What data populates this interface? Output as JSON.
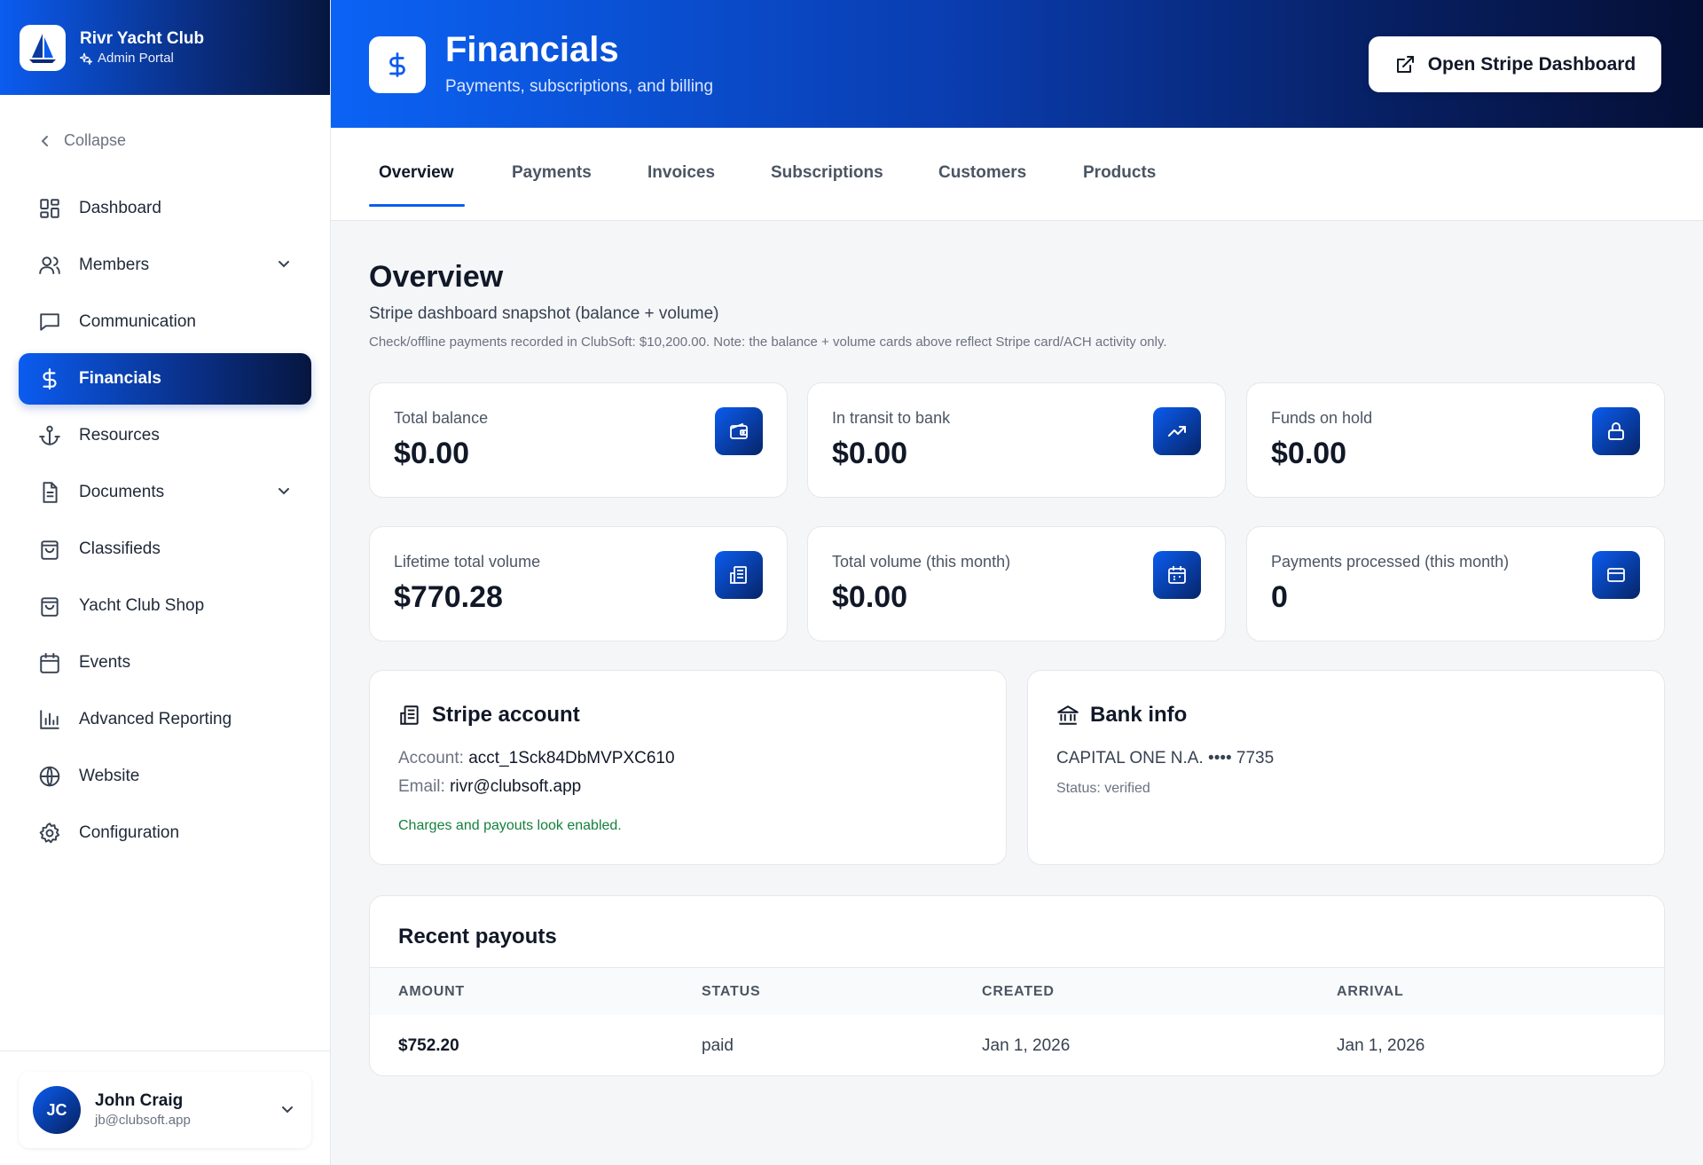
{
  "brand": {
    "name": "Rivr Yacht Club",
    "subtitle": "Admin Portal",
    "logo_icon": "sailboat-icon"
  },
  "sidebar": {
    "collapse_label": "Collapse",
    "items": [
      {
        "label": "Dashboard",
        "icon": "grid-icon"
      },
      {
        "label": "Members",
        "icon": "users-icon",
        "expandable": true
      },
      {
        "label": "Communication",
        "icon": "message-icon"
      },
      {
        "label": "Financials",
        "icon": "dollar-icon",
        "active": true
      },
      {
        "label": "Resources",
        "icon": "anchor-icon"
      },
      {
        "label": "Documents",
        "icon": "file-icon",
        "expandable": true
      },
      {
        "label": "Classifieds",
        "icon": "bag-icon"
      },
      {
        "label": "Yacht Club Shop",
        "icon": "bag-icon"
      },
      {
        "label": "Events",
        "icon": "calendar-icon"
      },
      {
        "label": "Advanced Reporting",
        "icon": "bar-chart-icon"
      },
      {
        "label": "Website",
        "icon": "globe-icon"
      },
      {
        "label": "Configuration",
        "icon": "gear-icon"
      }
    ]
  },
  "user": {
    "initials": "JC",
    "name": "John Craig",
    "email": "jb@clubsoft.app"
  },
  "header": {
    "title": "Financials",
    "subtitle": "Payments, subscriptions, and billing",
    "stripe_button_label": "Open Stripe Dashboard"
  },
  "tabs": [
    "Overview",
    "Payments",
    "Invoices",
    "Subscriptions",
    "Customers",
    "Products"
  ],
  "active_tab": "Overview",
  "overview": {
    "title": "Overview",
    "subtitle": "Stripe dashboard snapshot (balance + volume)",
    "note": "Check/offline payments recorded in ClubSoft: $10,200.00. Note: the balance + volume cards above reflect Stripe card/ACH activity only."
  },
  "stats": [
    {
      "label": "Total balance",
      "value": "$0.00",
      "icon": "wallet-icon"
    },
    {
      "label": "In transit to bank",
      "value": "$0.00",
      "icon": "trending-up-icon"
    },
    {
      "label": "Funds on hold",
      "value": "$0.00",
      "icon": "lock-icon"
    },
    {
      "label": "Lifetime total volume",
      "value": "$770.28",
      "icon": "building-icon"
    },
    {
      "label": "Total volume (this month)",
      "value": "$0.00",
      "icon": "calendar-icon"
    },
    {
      "label": "Payments processed (this month)",
      "value": "0",
      "icon": "credit-card-icon"
    }
  ],
  "stripe_account": {
    "title": "Stripe account",
    "account_label": "Account:",
    "account_value": "acct_1Sck84DbMVPXC610",
    "email_label": "Email:",
    "email_value": "rivr@clubsoft.app",
    "status_text": "Charges and payouts look enabled.",
    "status_color": "#15803d"
  },
  "bank_info": {
    "title": "Bank info",
    "bank_line": "CAPITAL ONE N.A. •••• 7735",
    "status": "Status: verified"
  },
  "payouts": {
    "title": "Recent payouts",
    "columns": [
      "AMOUNT",
      "STATUS",
      "CREATED",
      "ARRIVAL"
    ],
    "rows": [
      {
        "amount": "$752.20",
        "status": "paid",
        "created": "Jan 1, 2026",
        "arrival": "Jan 1, 2026"
      }
    ]
  },
  "colors": {
    "accent": "#0b5cf0",
    "accent_dark": "#06163f"
  }
}
